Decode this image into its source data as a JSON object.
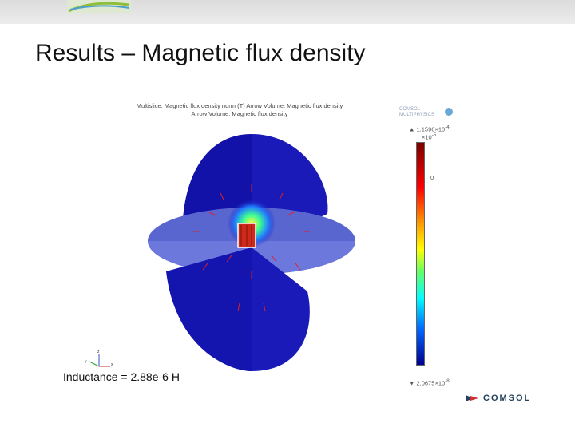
{
  "slide": {
    "title": "Results – Magnetic flux density",
    "inductance_text": "Inductance = 2.88e-6 H"
  },
  "plot": {
    "title_line1": "Multislice: Magnetic flux density norm (T)  Arrow Volume: Magnetic flux density",
    "title_line2": "Arrow Volume:  Magnetic flux density",
    "axes": {
      "x": "x",
      "y": "y",
      "z": "z"
    }
  },
  "colorbar": {
    "max_label": "▲ 1.1596×10",
    "max_exp": "-4",
    "scale_label": "×10",
    "scale_exp": "-5",
    "zero_label": "0",
    "min_label": "▼ 2.0675×10",
    "min_exp": "-8"
  },
  "brand": {
    "comsol_text": "COMSOL",
    "multiphysics_line1": "COMSOL",
    "multiphysics_line2": "MULTIPHYSICS",
    "accent": "#23415f"
  },
  "colors": {
    "field_blue": "#1b1bbf",
    "disk": "#5f6fd6",
    "coil_red": "#cc2a1a"
  }
}
